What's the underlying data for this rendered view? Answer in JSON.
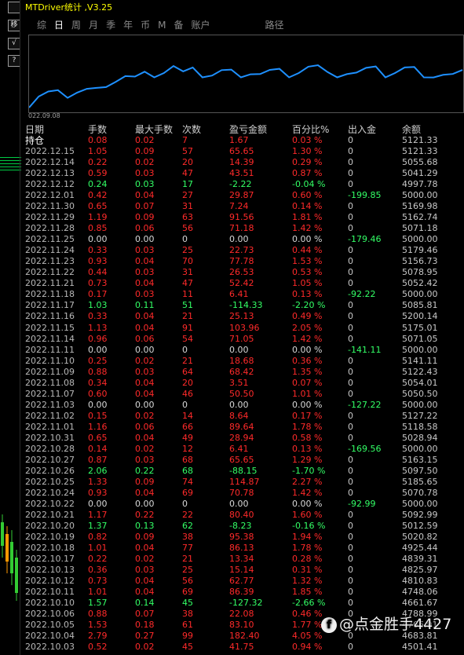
{
  "toolbar": {
    "b1": "",
    "b2": "移",
    "b3": "√",
    "b4": "?"
  },
  "window": {
    "title": "MTDriver统计 ,V3.25"
  },
  "tabs": [
    "综",
    "日",
    "周",
    "月",
    "季",
    "年",
    "币",
    "M",
    "备",
    "账户",
    "路径"
  ],
  "active_tab": "日",
  "chart": {
    "start_label": "022.09.08"
  },
  "headers": {
    "date": "日期",
    "lots": "手数",
    "max_lots": "最大手数",
    "count": "次数",
    "pnl": "盈亏金额",
    "pct": "百分比%",
    "io": "出入金",
    "balance": "余额"
  },
  "rows": [
    {
      "date": "持仓",
      "lots": "0.08",
      "max_lots": "0.02",
      "count": "7",
      "pnl": "1.67",
      "pct": "0.03 %",
      "io": "0",
      "balance": "5121.33",
      "sign": "pos"
    },
    {
      "date": "2022.12.15",
      "lots": "1.05",
      "max_lots": "0.09",
      "count": "57",
      "pnl": "65.65",
      "pct": "1.30 %",
      "io": "0",
      "balance": "5121.33",
      "sign": "pos"
    },
    {
      "date": "2022.12.14",
      "lots": "0.22",
      "max_lots": "0.02",
      "count": "20",
      "pnl": "14.39",
      "pct": "0.29 %",
      "io": "0",
      "balance": "5055.68",
      "sign": "pos"
    },
    {
      "date": "2022.12.13",
      "lots": "0.59",
      "max_lots": "0.03",
      "count": "47",
      "pnl": "43.51",
      "pct": "0.87 %",
      "io": "0",
      "balance": "5041.29",
      "sign": "pos"
    },
    {
      "date": "2022.12.12",
      "lots": "0.24",
      "max_lots": "0.03",
      "count": "17",
      "pnl": "-2.22",
      "pct": "-0.04 %",
      "io": "0",
      "balance": "4997.78",
      "sign": "neg"
    },
    {
      "date": "2022.12.01",
      "lots": "0.42",
      "max_lots": "0.04",
      "count": "27",
      "pnl": "29.87",
      "pct": "0.60 %",
      "io": "-199.85",
      "balance": "5000.00",
      "sign": "pos"
    },
    {
      "date": "2022.11.30",
      "lots": "0.65",
      "max_lots": "0.07",
      "count": "31",
      "pnl": "7.24",
      "pct": "0.14 %",
      "io": "0",
      "balance": "5169.98",
      "sign": "pos"
    },
    {
      "date": "2022.11.29",
      "lots": "1.19",
      "max_lots": "0.09",
      "count": "63",
      "pnl": "91.56",
      "pct": "1.81 %",
      "io": "0",
      "balance": "5162.74",
      "sign": "pos"
    },
    {
      "date": "2022.11.28",
      "lots": "0.85",
      "max_lots": "0.06",
      "count": "56",
      "pnl": "71.18",
      "pct": "1.42 %",
      "io": "0",
      "balance": "5071.18",
      "sign": "pos"
    },
    {
      "date": "2022.11.25",
      "lots": "0.00",
      "max_lots": "0.00",
      "count": "0",
      "pnl": "0.00",
      "pct": "0.00 %",
      "io": "-179.46",
      "balance": "5000.00",
      "sign": "zero"
    },
    {
      "date": "2022.11.24",
      "lots": "0.33",
      "max_lots": "0.03",
      "count": "25",
      "pnl": "22.73",
      "pct": "0.44 %",
      "io": "0",
      "balance": "5179.46",
      "sign": "pos"
    },
    {
      "date": "2022.11.23",
      "lots": "0.93",
      "max_lots": "0.04",
      "count": "70",
      "pnl": "77.78",
      "pct": "1.53 %",
      "io": "0",
      "balance": "5156.73",
      "sign": "pos"
    },
    {
      "date": "2022.11.22",
      "lots": "0.44",
      "max_lots": "0.03",
      "count": "31",
      "pnl": "26.53",
      "pct": "0.53 %",
      "io": "0",
      "balance": "5078.95",
      "sign": "pos"
    },
    {
      "date": "2022.11.21",
      "lots": "0.73",
      "max_lots": "0.04",
      "count": "47",
      "pnl": "52.42",
      "pct": "1.05 %",
      "io": "0",
      "balance": "5052.42",
      "sign": "pos"
    },
    {
      "date": "2022.11.18",
      "lots": "0.17",
      "max_lots": "0.03",
      "count": "11",
      "pnl": "6.41",
      "pct": "0.13 %",
      "io": "-92.22",
      "balance": "5000.00",
      "sign": "pos"
    },
    {
      "date": "2022.11.17",
      "lots": "1.03",
      "max_lots": "0.11",
      "count": "51",
      "pnl": "-114.33",
      "pct": "-2.20 %",
      "io": "0",
      "balance": "5085.81",
      "sign": "neg"
    },
    {
      "date": "2022.11.16",
      "lots": "0.33",
      "max_lots": "0.04",
      "count": "21",
      "pnl": "25.13",
      "pct": "0.49 %",
      "io": "0",
      "balance": "5200.14",
      "sign": "pos"
    },
    {
      "date": "2022.11.15",
      "lots": "1.13",
      "max_lots": "0.04",
      "count": "91",
      "pnl": "103.96",
      "pct": "2.05 %",
      "io": "0",
      "balance": "5175.01",
      "sign": "pos"
    },
    {
      "date": "2022.11.14",
      "lots": "0.96",
      "max_lots": "0.06",
      "count": "54",
      "pnl": "71.05",
      "pct": "1.42 %",
      "io": "0",
      "balance": "5071.05",
      "sign": "pos"
    },
    {
      "date": "2022.11.11",
      "lots": "0.00",
      "max_lots": "0.00",
      "count": "0",
      "pnl": "0.00",
      "pct": "0.00 %",
      "io": "-141.11",
      "balance": "5000.00",
      "sign": "zero"
    },
    {
      "date": "2022.11.10",
      "lots": "0.25",
      "max_lots": "0.02",
      "count": "21",
      "pnl": "18.68",
      "pct": "0.36 %",
      "io": "0",
      "balance": "5141.11",
      "sign": "pos"
    },
    {
      "date": "2022.11.09",
      "lots": "0.88",
      "max_lots": "0.03",
      "count": "64",
      "pnl": "68.42",
      "pct": "1.35 %",
      "io": "0",
      "balance": "5122.43",
      "sign": "pos"
    },
    {
      "date": "2022.11.08",
      "lots": "0.34",
      "max_lots": "0.04",
      "count": "20",
      "pnl": "3.51",
      "pct": "0.07 %",
      "io": "0",
      "balance": "5054.01",
      "sign": "pos"
    },
    {
      "date": "2022.11.07",
      "lots": "0.60",
      "max_lots": "0.04",
      "count": "46",
      "pnl": "50.50",
      "pct": "1.01 %",
      "io": "0",
      "balance": "5050.50",
      "sign": "pos"
    },
    {
      "date": "2022.11.03",
      "lots": "0.00",
      "max_lots": "0.00",
      "count": "0",
      "pnl": "0.00",
      "pct": "0.00 %",
      "io": "-127.22",
      "balance": "5000.00",
      "sign": "zero"
    },
    {
      "date": "2022.11.02",
      "lots": "0.15",
      "max_lots": "0.02",
      "count": "14",
      "pnl": "8.64",
      "pct": "0.17 %",
      "io": "0",
      "balance": "5127.22",
      "sign": "pos"
    },
    {
      "date": "2022.11.01",
      "lots": "1.16",
      "max_lots": "0.06",
      "count": "66",
      "pnl": "89.64",
      "pct": "1.78 %",
      "io": "0",
      "balance": "5118.58",
      "sign": "pos"
    },
    {
      "date": "2022.10.31",
      "lots": "0.65",
      "max_lots": "0.04",
      "count": "49",
      "pnl": "28.94",
      "pct": "0.58 %",
      "io": "0",
      "balance": "5028.94",
      "sign": "pos"
    },
    {
      "date": "2022.10.28",
      "lots": "0.14",
      "max_lots": "0.02",
      "count": "12",
      "pnl": "6.41",
      "pct": "0.13 %",
      "io": "-169.56",
      "balance": "5000.00",
      "sign": "pos"
    },
    {
      "date": "2022.10.27",
      "lots": "0.87",
      "max_lots": "0.03",
      "count": "68",
      "pnl": "65.65",
      "pct": "1.29 %",
      "io": "0",
      "balance": "5163.15",
      "sign": "pos"
    },
    {
      "date": "2022.10.26",
      "lots": "2.06",
      "max_lots": "0.22",
      "count": "68",
      "pnl": "-88.15",
      "pct": "-1.70 %",
      "io": "0",
      "balance": "5097.50",
      "sign": "neg"
    },
    {
      "date": "2022.10.25",
      "lots": "1.33",
      "max_lots": "0.09",
      "count": "74",
      "pnl": "114.87",
      "pct": "2.27 %",
      "io": "0",
      "balance": "5185.65",
      "sign": "pos"
    },
    {
      "date": "2022.10.24",
      "lots": "0.93",
      "max_lots": "0.04",
      "count": "69",
      "pnl": "70.78",
      "pct": "1.42 %",
      "io": "0",
      "balance": "5070.78",
      "sign": "pos"
    },
    {
      "date": "2022.10.22",
      "lots": "0.00",
      "max_lots": "0.00",
      "count": "0",
      "pnl": "0.00",
      "pct": "0.00 %",
      "io": "-92.99",
      "balance": "5000.00",
      "sign": "zero"
    },
    {
      "date": "2022.10.21",
      "lots": "1.17",
      "max_lots": "0.22",
      "count": "22",
      "pnl": "80.40",
      "pct": "1.60 %",
      "io": "0",
      "balance": "5092.99",
      "sign": "pos"
    },
    {
      "date": "2022.10.20",
      "lots": "1.37",
      "max_lots": "0.13",
      "count": "62",
      "pnl": "-8.23",
      "pct": "-0.16 %",
      "io": "0",
      "balance": "5012.59",
      "sign": "neg"
    },
    {
      "date": "2022.10.19",
      "lots": "0.82",
      "max_lots": "0.09",
      "count": "38",
      "pnl": "95.38",
      "pct": "1.94 %",
      "io": "0",
      "balance": "5020.82",
      "sign": "pos"
    },
    {
      "date": "2022.10.18",
      "lots": "1.01",
      "max_lots": "0.04",
      "count": "77",
      "pnl": "86.13",
      "pct": "1.78 %",
      "io": "0",
      "balance": "4925.44",
      "sign": "pos"
    },
    {
      "date": "2022.10.17",
      "lots": "0.22",
      "max_lots": "0.02",
      "count": "21",
      "pnl": "13.34",
      "pct": "0.28 %",
      "io": "0",
      "balance": "4839.31",
      "sign": "pos"
    },
    {
      "date": "2022.10.13",
      "lots": "0.36",
      "max_lots": "0.03",
      "count": "25",
      "pnl": "15.14",
      "pct": "0.31 %",
      "io": "0",
      "balance": "4825.97",
      "sign": "pos"
    },
    {
      "date": "2022.10.12",
      "lots": "0.73",
      "max_lots": "0.04",
      "count": "56",
      "pnl": "62.77",
      "pct": "1.32 %",
      "io": "0",
      "balance": "4810.83",
      "sign": "pos"
    },
    {
      "date": "2022.10.11",
      "lots": "1.01",
      "max_lots": "0.04",
      "count": "69",
      "pnl": "86.39",
      "pct": "1.85 %",
      "io": "0",
      "balance": "4748.06",
      "sign": "pos"
    },
    {
      "date": "2022.10.10",
      "lots": "1.57",
      "max_lots": "0.14",
      "count": "45",
      "pnl": "-127.32",
      "pct": "-2.66 %",
      "io": "0",
      "balance": "4661.67",
      "sign": "neg"
    },
    {
      "date": "2022.10.06",
      "lots": "0.88",
      "max_lots": "0.07",
      "count": "38",
      "pnl": "22.08",
      "pct": "0.46 %",
      "io": "0",
      "balance": "4788.99",
      "sign": "pos"
    },
    {
      "date": "2022.10.05",
      "lots": "1.53",
      "max_lots": "0.18",
      "count": "61",
      "pnl": "83.10",
      "pct": "1.77 %",
      "io": "0",
      "balance": "4766.91",
      "sign": "pos"
    },
    {
      "date": "2022.10.04",
      "lots": "2.79",
      "max_lots": "0.27",
      "count": "99",
      "pnl": "182.40",
      "pct": "4.05 %",
      "io": "0",
      "balance": "4683.81",
      "sign": "pos"
    },
    {
      "date": "2022.10.03",
      "lots": "0.52",
      "max_lots": "0.02",
      "count": "45",
      "pnl": "41.75",
      "pct": "0.94 %",
      "io": "0",
      "balance": "4501.41",
      "sign": "pos"
    }
  ],
  "watermark": {
    "icon": "f",
    "text": "@点金胜手4427"
  },
  "colors": {
    "profit": "#ff2a2a",
    "loss": "#33ff66",
    "neutral": "#d8d8d8",
    "title": "#ffff00",
    "chart_line": "#1e90ff"
  }
}
